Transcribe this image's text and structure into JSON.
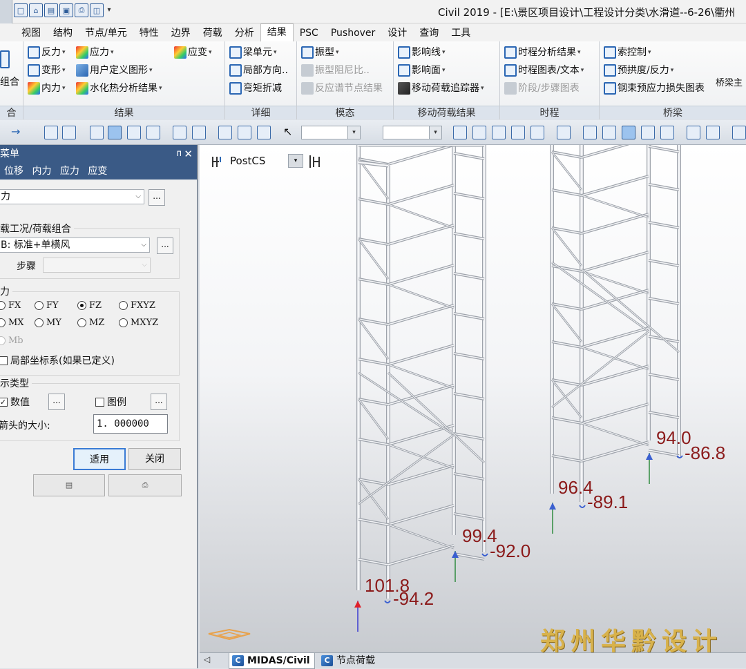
{
  "window": {
    "title": "Civil 2019 - [E:\\景区项目设计\\工程设计分类\\水滑道--6-26\\衢州"
  },
  "ribbon": {
    "tabs": [
      "视图",
      "结构",
      "节点/单元",
      "特性",
      "边界",
      "荷载",
      "分析",
      "结果",
      "PSC",
      "Pushover",
      "设计",
      "查询",
      "工具"
    ],
    "active_tab": "结果",
    "groups": {
      "combo": {
        "label": "合",
        "button": "组合"
      },
      "results": {
        "label": "结果",
        "reaction": "反力",
        "stress": "应力",
        "strain": "应变",
        "deformation": "变形",
        "user_defined": "用户定义图形",
        "internal_force": "内力",
        "hydration": "水化热分析结果"
      },
      "detail": {
        "label": "详细",
        "beam_element": "梁单元",
        "local_direction": "局部方向..",
        "moment_reduction": "弯矩折减"
      },
      "mode": {
        "label": "模态",
        "mode_shape": "振型",
        "damping_ratio": "振型阻尼比..",
        "spectrum_nodes": "反应谱节点结果"
      },
      "moving": {
        "label": "移动荷载结果",
        "influence_line": "影响线",
        "influence_surface": "影响面",
        "tracker": "移动荷载追踪器"
      },
      "time_history": {
        "label": "时程",
        "analysis_results": "时程分析结果",
        "graph_text": "时程图表/文本",
        "stage_graph": "阶段/步骤图表"
      },
      "bridge": {
        "label": "桥梁",
        "cable_control": "索控制",
        "camber": "预拱度/反力",
        "tendon_loss": "钢束预应力损失图表",
        "bridge_main": "桥梁主"
      }
    }
  },
  "toolbar": {
    "combo1_value": "",
    "combo2_value": ""
  },
  "panel": {
    "title": "菜单",
    "tabs": [
      "位移",
      "内力",
      "应力",
      "应变"
    ],
    "result_type": "力",
    "load_case_section": "载工况/荷载组合",
    "load_case_value": "B: 标准+单横风",
    "step_label": "步骤",
    "step_value": "",
    "force_section": "力",
    "radios": [
      {
        "label": "FX",
        "checked": false
      },
      {
        "label": "FY",
        "checked": false
      },
      {
        "label": "FZ",
        "checked": true
      },
      {
        "label": "FXYZ",
        "checked": false
      },
      {
        "label": "MX",
        "checked": false
      },
      {
        "label": "MY",
        "checked": false
      },
      {
        "label": "MZ",
        "checked": false
      },
      {
        "label": "MXYZ",
        "checked": false
      },
      {
        "label": "Mb",
        "checked": false
      }
    ],
    "local_coord_label": "局部坐标系(如果已定义)",
    "display_section": "示类型",
    "values_label": "数值",
    "values_checked": true,
    "legend_label": "图例",
    "legend_checked": false,
    "arrow_size_label": "箭头的大小:",
    "arrow_size_value": "1. 000000",
    "dots": "...",
    "apply_button": "适用",
    "close_button": "关闭"
  },
  "viewport": {
    "stage_label": "PostCS",
    "watermark": "郑州华黔设计",
    "reactions": [
      {
        "value": "101.8",
        "color": "#8b1a1a"
      },
      {
        "value": "-94.2",
        "color": "#8b1a1a"
      },
      {
        "value": "99.4",
        "color": "#8b1a1a"
      },
      {
        "value": "-92.0",
        "color": "#8b1a1a"
      },
      {
        "value": "96.4",
        "color": "#8b1a1a"
      },
      {
        "value": "-89.1",
        "color": "#8b1a1a"
      },
      {
        "value": "94.0",
        "color": "#8b1a1a"
      },
      {
        "value": "-86.8",
        "color": "#8b1a1a"
      }
    ]
  },
  "bottom_tabs": {
    "midas": "MIDAS/Civil",
    "node_load": "节点荷载",
    "icon_letter": "C"
  },
  "colors": {
    "panel_header": "#3a5a86",
    "reaction_text": "#8b1a1a",
    "up_arrow": "#3a5fd0",
    "max_arrow": "#e0202a",
    "watermark": "#d8b24c"
  }
}
